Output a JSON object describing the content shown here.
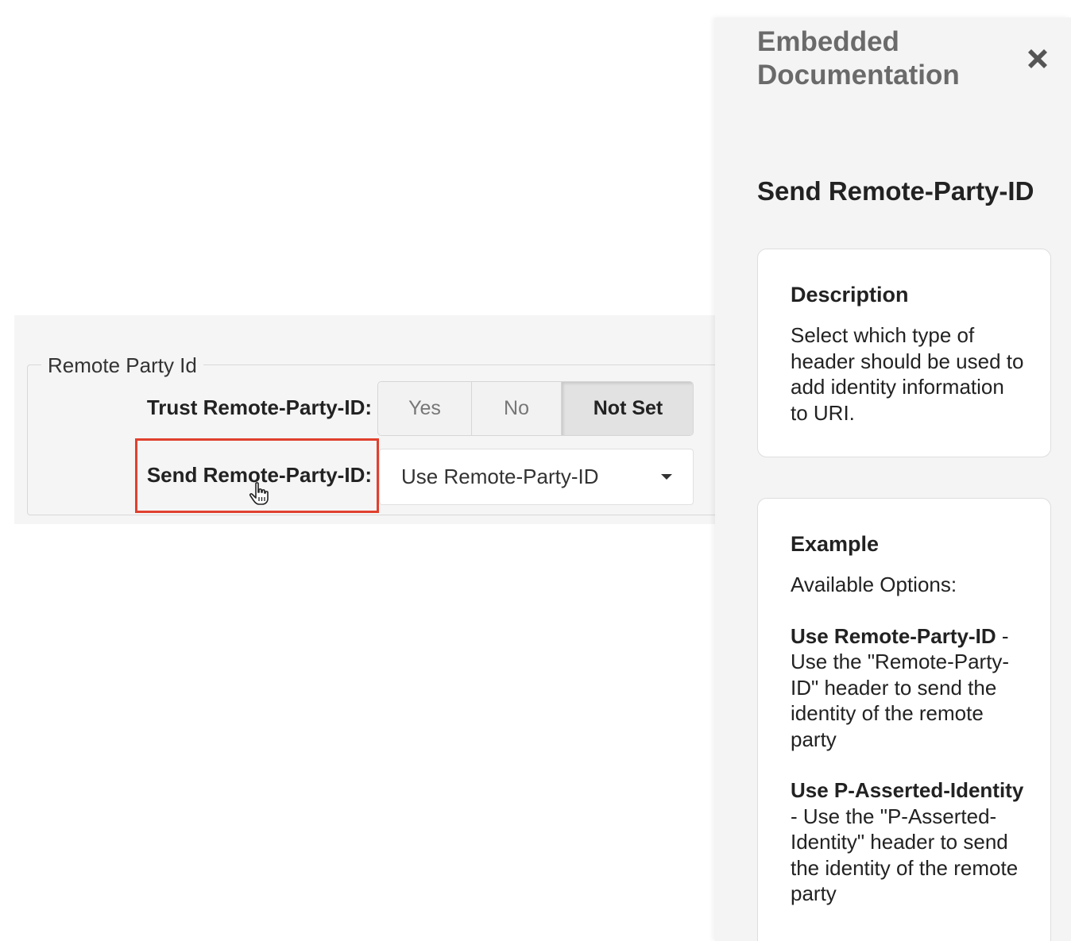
{
  "settings": {
    "group_legend": "Remote Party Id",
    "trust": {
      "label": "Trust Remote-Party-ID:",
      "options": [
        "Yes",
        "No",
        "Not Set"
      ],
      "selected": "Not Set"
    },
    "send": {
      "label": "Send Remote-Party-ID:",
      "value": "Use Remote-Party-ID"
    }
  },
  "doc_panel": {
    "title": "Embedded Documentation",
    "heading": "Send Remote-Party-ID",
    "description": {
      "title": "Description",
      "text": "Select which type of header should be used to add identity information to URI."
    },
    "example": {
      "title": "Example",
      "intro": "Available Options:",
      "options": [
        {
          "name": "Use Remote-Party-ID",
          "desc": " - Use the \"Remote-Party-ID\" header to send the identity of the remote party"
        },
        {
          "name": "Use P-Asserted-Identity",
          "desc": " - Use the \"P-Asserted-Identity\" header to send the identity of the remote party"
        }
      ]
    }
  },
  "colors": {
    "highlight": "#e0402e",
    "panel_bg": "#f4f4f4",
    "band_bg": "#f5f5f5"
  },
  "icons": {
    "close": "close-icon",
    "cursor": "hand-pointer-icon",
    "caret": "caret-down-icon"
  }
}
